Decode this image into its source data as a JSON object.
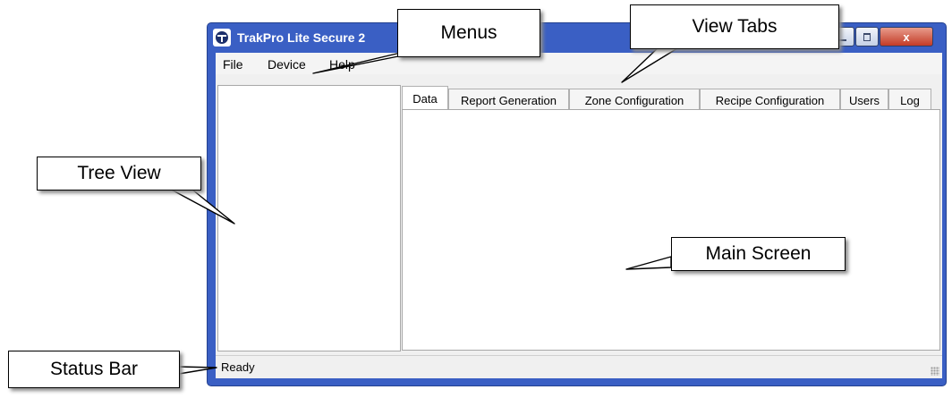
{
  "window": {
    "title": "TrakPro Lite Secure 2",
    "close_glyph": "x"
  },
  "menu": [
    "File",
    "Device",
    "Help"
  ],
  "tabs": [
    "Data",
    "Report Generation",
    "Zone Configuration",
    "Recipe Configuration",
    "Users",
    "Log"
  ],
  "status": {
    "text": "Ready"
  },
  "callouts": {
    "menus": "Menus",
    "view_tabs": "View Tabs",
    "tree_view": "Tree View",
    "main_screen": "Main Screen",
    "status_bar": "Status Bar"
  },
  "colors": {
    "title_bar": "#3a5fc4",
    "client_bg": "#f0f0f0",
    "close_button": "#c33b26"
  },
  "icons": [
    "tsi-logo-icon",
    "minimize-icon",
    "maximize-icon",
    "close-icon",
    "resize-grip-icon"
  ]
}
